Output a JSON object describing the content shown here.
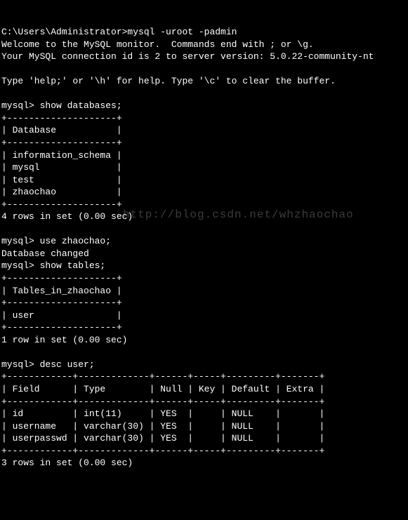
{
  "lines": {
    "l1": "C:\\Users\\Administrator>mysql -uroot -padmin",
    "l2": "Welcome to the MySQL monitor.  Commands end with ; or \\g.",
    "l3": "Your MySQL connection id is 2 to server version: 5.0.22-community-nt",
    "l4": "",
    "l5": "Type 'help;' or '\\h' for help. Type '\\c' to clear the buffer.",
    "l6": "",
    "l7": "mysql> show databases;",
    "l8": "+--------------------+",
    "l9": "| Database           |",
    "l10": "+--------------------+",
    "l11": "| information_schema |",
    "l12": "| mysql              |",
    "l13": "| test               |",
    "l14": "| zhaochao           |",
    "l15": "+--------------------+",
    "l16": "4 rows in set (0.00 sec)",
    "l17": "",
    "l18": "mysql> use zhaochao;",
    "l19": "Database changed",
    "l20": "mysql> show tables;",
    "l21": "+--------------------+",
    "l22": "| Tables_in_zhaochao |",
    "l23": "+--------------------+",
    "l24": "| user               |",
    "l25": "+--------------------+",
    "l26": "1 row in set (0.00 sec)",
    "l27": "",
    "l28": "mysql> desc user;",
    "l29": "+------------+-------------+------+-----+---------+-------+",
    "l30": "| Field      | Type        | Null | Key | Default | Extra |",
    "l31": "+------------+-------------+------+-----+---------+-------+",
    "l32": "| id         | int(11)     | YES  |     | NULL    |       |",
    "l33": "| username   | varchar(30) | YES  |     | NULL    |       |",
    "l34": "| userpasswd | varchar(30) | YES  |     | NULL    |       |",
    "l35": "+------------+-------------+------+-----+---------+-------+",
    "l36": "3 rows in set (0.00 sec)"
  },
  "watermark": "http://blog.csdn.net/whzhaochao"
}
